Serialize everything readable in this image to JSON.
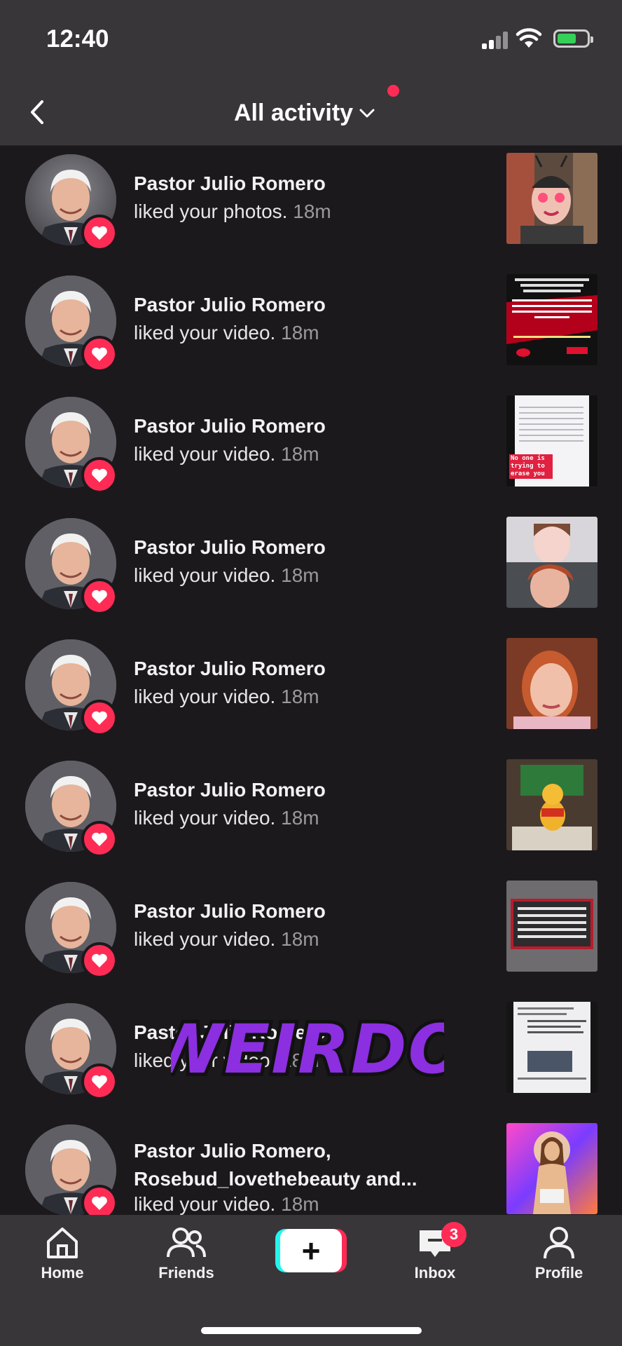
{
  "status_bar": {
    "time": "12:40"
  },
  "header": {
    "title": "All activity",
    "back_icon": "chevron-left-icon",
    "dropdown_icon": "chevron-down-icon"
  },
  "activities": [
    {
      "name": "Pastor Julio Romero",
      "action": "liked your photos.",
      "time": "18m",
      "thumb": "photo-thumbnail"
    },
    {
      "name": "Pastor Julio Romero",
      "action": "liked your video.",
      "time": "18m",
      "thumb": "video-thumbnail"
    },
    {
      "name": "Pastor Julio Romero",
      "action": "liked your video.",
      "time": "18m",
      "thumb": "video-thumbnail",
      "thumb_caption": "No one is trying to erase you"
    },
    {
      "name": "Pastor Julio Romero",
      "action": "liked your video.",
      "time": "18m",
      "thumb": "video-thumbnail"
    },
    {
      "name": "Pastor Julio Romero",
      "action": "liked your video.",
      "time": "18m",
      "thumb": "video-thumbnail"
    },
    {
      "name": "Pastor Julio Romero",
      "action": "liked your video.",
      "time": "18m",
      "thumb": "video-thumbnail"
    },
    {
      "name": "Pastor Julio Romero",
      "action": "liked your video.",
      "time": "18m",
      "thumb": "video-thumbnail"
    },
    {
      "name": "Pastor Julio Romero",
      "action": "liked your video.",
      "time": "18m",
      "thumb": "video-thumbnail"
    },
    {
      "name": "Pastor Julio Romero,\nRosebud_lovethebeauty and...",
      "action": "liked your video.",
      "time": "18m",
      "thumb": "video-thumbnail"
    }
  ],
  "sticker": {
    "text": "WEIRDO"
  },
  "tabbar": {
    "home": "Home",
    "friends": "Friends",
    "inbox": "Inbox",
    "inbox_badge": "3",
    "profile": "Profile",
    "create_icon": "plus-icon"
  },
  "colors": {
    "accent": "#fe2c55",
    "cyan": "#25f4ee",
    "background": "#1c191d",
    "bar": "#39363a",
    "sticker_purple": "#8b2fe0"
  }
}
